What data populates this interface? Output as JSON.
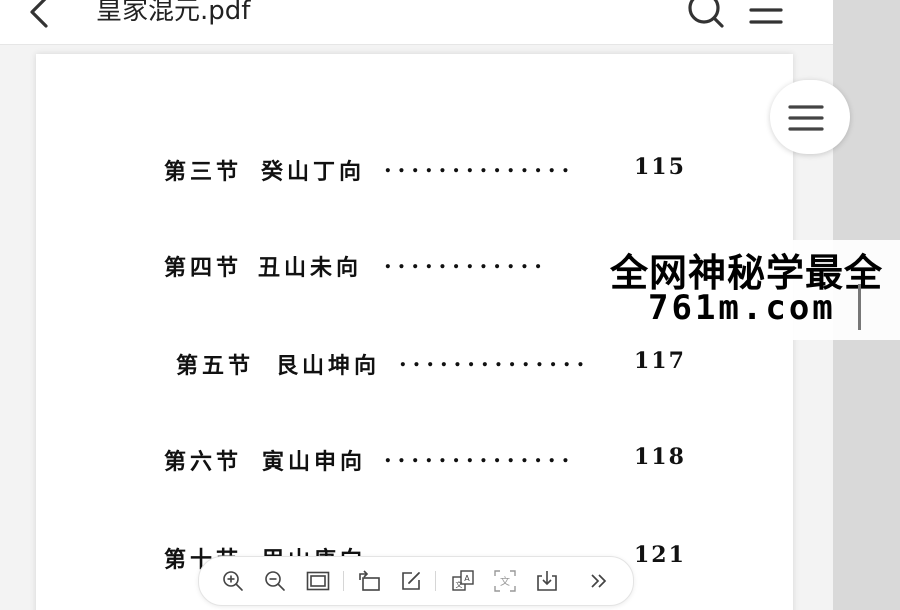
{
  "header": {
    "title": "皇家混元.pdf",
    "icons": [
      "chevron-left-icon",
      "search-icon",
      "list-icon"
    ]
  },
  "toc": [
    {
      "section": "第三节",
      "heading": "癸山丁向",
      "dots": "..............",
      "page": "115"
    },
    {
      "section": "第四节",
      "heading": "丑山未向",
      "dots": "............",
      "page": ""
    },
    {
      "section": "第五节",
      "heading": "艮山坤向",
      "dots": "..............",
      "page": "117"
    },
    {
      "section": "第六节",
      "heading": "寅山申向",
      "dots": "..............",
      "page": "118"
    },
    {
      "section": "第十节",
      "heading": "甲山庚向",
      "dots": "",
      "page": "121"
    }
  ],
  "watermark": {
    "line1": "全网神秘学最全",
    "line2": "761m.com"
  },
  "toolbar": {
    "icons": [
      "zoom-in-icon",
      "zoom-out-icon",
      "fit-page-icon",
      "rotate-icon",
      "edit-icon",
      "translate-icon",
      "ocr-icon",
      "download-icon",
      "more-icon"
    ]
  },
  "colors": {
    "icon": "#444444",
    "text": "#111111",
    "page_bg": "#ffffff",
    "app_bg": "#f3f3f3",
    "side_bg": "#d9d9d9"
  }
}
